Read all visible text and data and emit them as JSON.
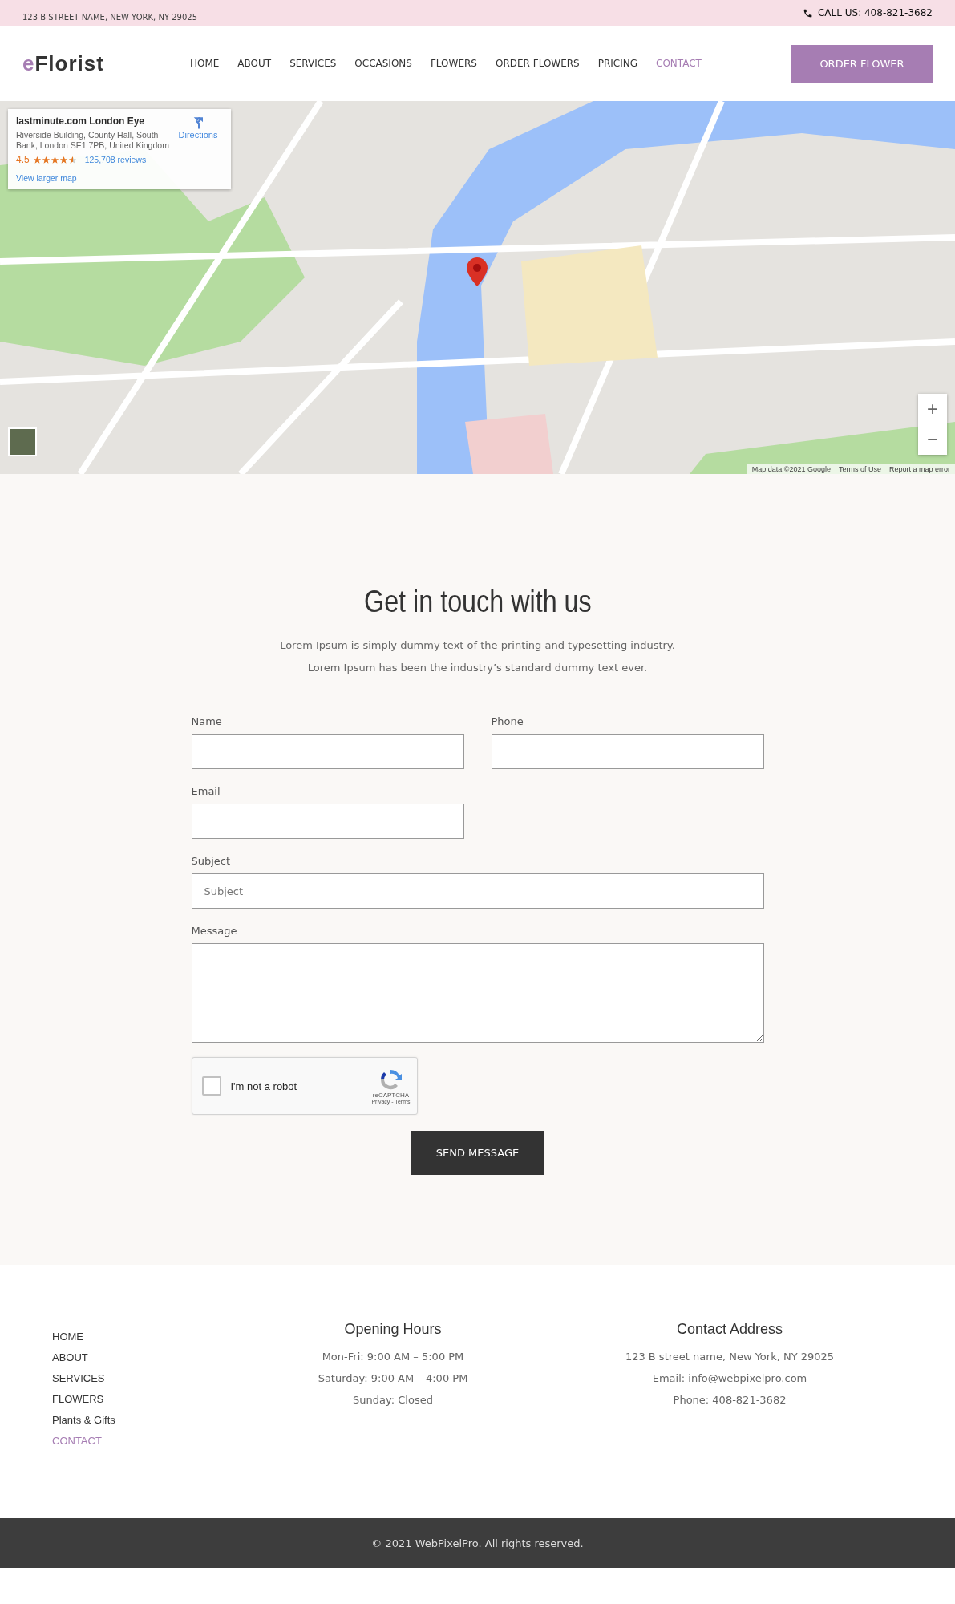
{
  "top_bar": {
    "address": "123 B STREET NAME, NEW YORK, NY 29025",
    "phone": "CALL US: 408-821-3682"
  },
  "header": {
    "logo": {
      "accent": "e",
      "rest": "Florist"
    },
    "nav": [
      {
        "label": "HOME",
        "selected": false
      },
      {
        "label": "ABOUT",
        "selected": false
      },
      {
        "label": "SERVICES",
        "selected": false
      },
      {
        "label": "OCCASIONS",
        "selected": false
      },
      {
        "label": "FLOWERS",
        "selected": false
      },
      {
        "label": "ORDER FLOWERS",
        "selected": false
      },
      {
        "label": "PRICING",
        "selected": false
      },
      {
        "label": "CONTACT",
        "selected": true
      }
    ],
    "cta": "ORDER FLOWER"
  },
  "map": {
    "place_card": {
      "title": "lastminute.com London Eye",
      "address": "Riverside Building, County Hall, South Bank, London SE1 7PB, United Kingdom",
      "rating": "4.5",
      "stars": 4.5,
      "reviews": "125,708 reviews",
      "directions": "Directions",
      "larger_map": "View larger map"
    },
    "zoom_in": "+",
    "zoom_out": "−",
    "attribution": [
      "Map data ©2021 Google",
      "Terms of Use",
      "Report a map error"
    ]
  },
  "contact": {
    "title": "Get in touch with us",
    "intro": [
      "Lorem Ipsum is simply dummy text of the printing and typesetting industry.",
      "Lorem Ipsum has been the industry’s standard dummy text ever."
    ],
    "fields": [
      {
        "label": "Name",
        "kind": "half"
      },
      {
        "label": "Phone",
        "kind": "half"
      },
      {
        "label": "Email",
        "kind": "half"
      },
      {
        "label": "Subject",
        "kind": "full",
        "placeholder": "Subject"
      },
      {
        "label": "Message",
        "kind": "area"
      }
    ],
    "captcha": {
      "label": "I'm not a robot",
      "checked": false,
      "brand": "reCAPTCHA",
      "links": "Privacy - Terms"
    },
    "submit": "SEND MESSAGE"
  },
  "footer": {
    "links": [
      {
        "label": "HOME",
        "selected": false
      },
      {
        "label": "ABOUT",
        "selected": false
      },
      {
        "label": "SERVICES",
        "selected": false
      },
      {
        "label": "FLOWERS",
        "selected": false
      },
      {
        "label": "Plants & Gifts",
        "selected": false
      },
      {
        "label": "CONTACT",
        "selected": true
      }
    ],
    "columns": [
      {
        "title": "Opening Hours",
        "lines": [
          "Mon-Fri: 9:00 AM – 5:00 PM",
          "Saturday: 9:00 AM – 4:00 PM",
          "Sunday: Closed"
        ]
      },
      {
        "title": "Contact Address",
        "lines": [
          "123 B street name, New York, NY 29025",
          "Email: info@webpixelpro.com",
          "Phone: 408-821-3682"
        ]
      }
    ],
    "copyright": "© 2021 WebPixelPro. All rights reserved."
  }
}
